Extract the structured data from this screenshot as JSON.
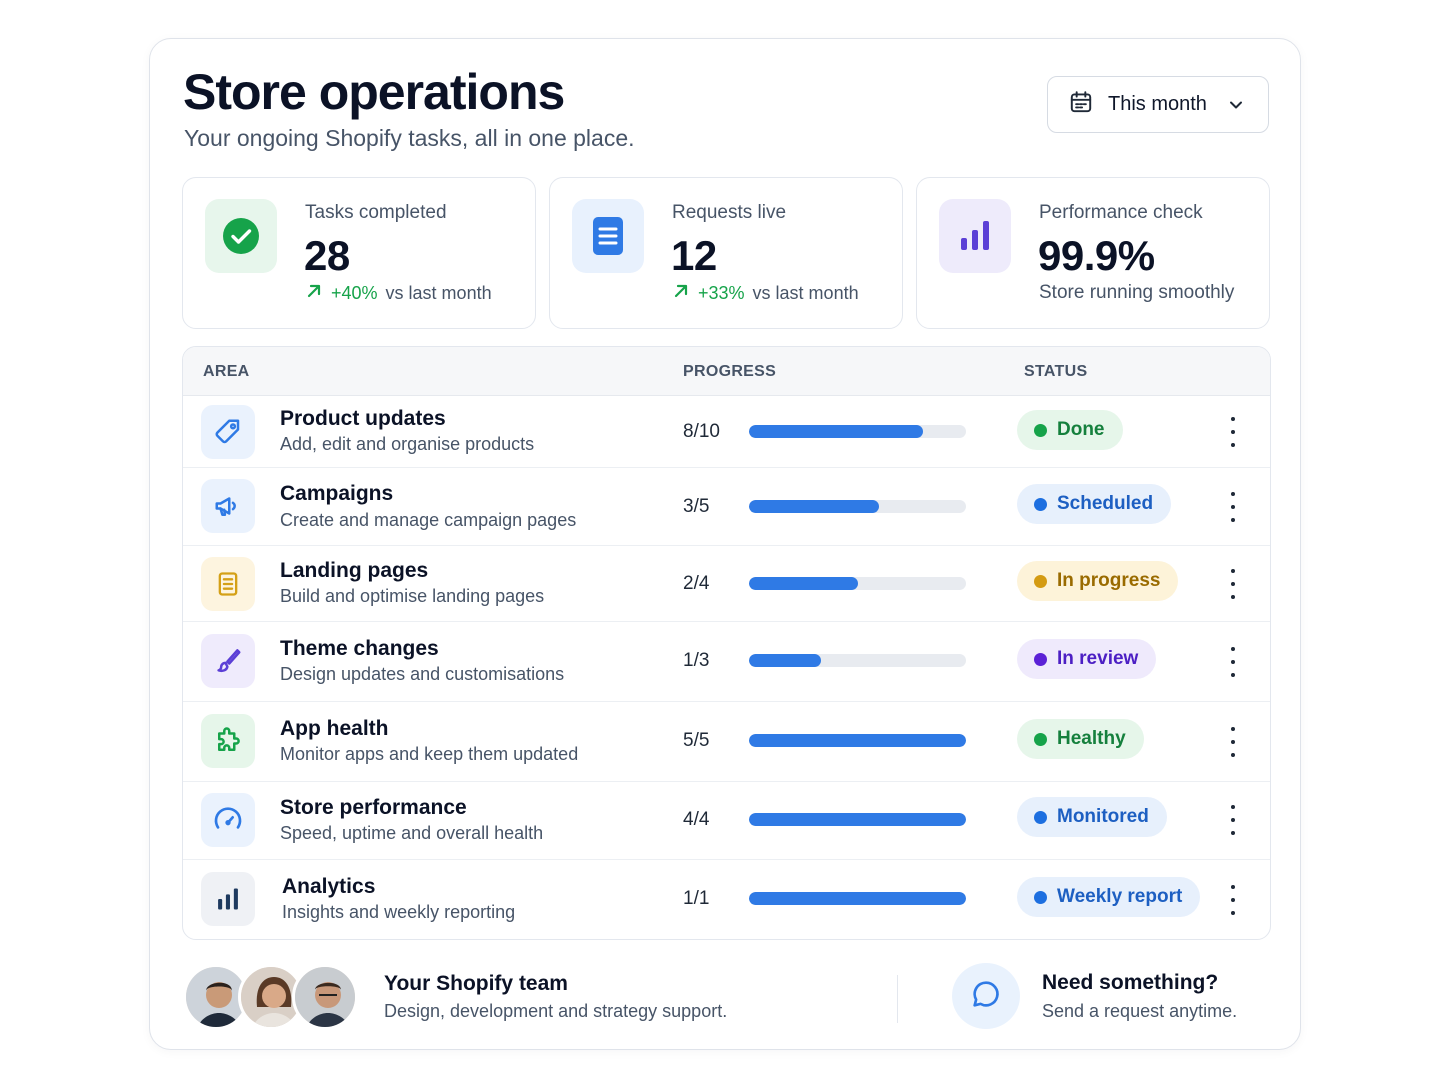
{
  "header": {
    "title": "Store operations",
    "subtitle": "Your ongoing Shopify tasks, all in one place.",
    "period_select": {
      "value": "This month",
      "icon": "calendar-icon"
    }
  },
  "stats": [
    {
      "label": "Tasks completed",
      "value": "28",
      "delta": "+40%",
      "delta_note": "vs last month",
      "icon": "check-circle-icon",
      "accent": "#16a34a"
    },
    {
      "label": "Requests live",
      "value": "12",
      "delta": "+33%",
      "delta_note": "vs last month",
      "icon": "document-icon",
      "accent": "#2f7ae5"
    },
    {
      "label": "Performance check",
      "value": "99.9%",
      "note": "Store running smoothly",
      "icon": "bar-chart-icon",
      "accent": "#5b3fd6"
    }
  ],
  "table": {
    "columns": {
      "area": "AREA",
      "progress": "PROGRESS",
      "status": "STATUS"
    },
    "rows": [
      {
        "name": "Product updates",
        "desc": "Add, edit and organise products",
        "count": "8/10",
        "progress": 0.8,
        "status": "Done",
        "icon": "tag-icon"
      },
      {
        "name": "Campaigns",
        "desc": "Create and manage campaign pages",
        "count": "3/5",
        "progress": 0.6,
        "status": "Scheduled",
        "icon": "megaphone-icon"
      },
      {
        "name": "Landing pages",
        "desc": "Build and optimise landing pages",
        "count": "2/4",
        "progress": 0.5,
        "status": "In progress",
        "icon": "page-icon"
      },
      {
        "name": "Theme changes",
        "desc": "Design updates and customisations",
        "count": "1/3",
        "progress": 0.33,
        "status": "In review",
        "icon": "brush-icon"
      },
      {
        "name": "App health",
        "desc": "Monitor apps and keep them updated",
        "count": "5/5",
        "progress": 1.0,
        "status": "Healthy",
        "icon": "puzzle-icon"
      },
      {
        "name": "Store performance",
        "desc": "Speed, uptime and overall health",
        "count": "4/4",
        "progress": 1.0,
        "status": "Monitored",
        "icon": "gauge-icon"
      },
      {
        "name": "Analytics",
        "desc": "Insights and weekly reporting",
        "count": "1/1",
        "progress": 1.0,
        "status": "Weekly report",
        "icon": "bar-chart-icon"
      }
    ]
  },
  "footer": {
    "team_title": "Your Shopify team",
    "team_sub": "Design, development and strategy support.",
    "need_title": "Need something?",
    "need_sub": "Send a request anytime."
  },
  "colors": {
    "progress_fill": "#2f7ae5",
    "done": "#16a34a",
    "scheduled": "#1d6fe0",
    "in_progress": "#b8860b",
    "in_review": "#5b21d6",
    "healthy": "#16a34a",
    "monitored": "#1d6fe0",
    "weekly_report": "#1d6fe0"
  }
}
